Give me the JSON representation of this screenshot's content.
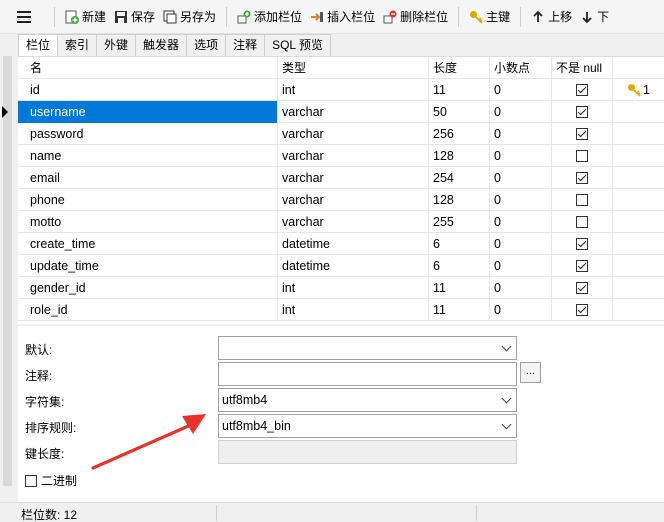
{
  "toolbar": {
    "new_label": "新建",
    "save_label": "保存",
    "save_as_label": "另存为",
    "add_field_label": "添加栏位",
    "insert_field_label": "插入栏位",
    "delete_field_label": "删除栏位",
    "primary_key_label": "主键",
    "move_up_label": "上移",
    "move_down_label": "下"
  },
  "tabs": [
    "栏位",
    "索引",
    "外键",
    "触发器",
    "选项",
    "注释",
    "SQL 预览"
  ],
  "grid": {
    "headers": {
      "name": "名",
      "type": "类型",
      "length": "长度",
      "decimals": "小数点",
      "not_null": "不是 null",
      "key": ""
    },
    "rows": [
      {
        "name": "id",
        "type": "int",
        "length": "11",
        "decimals": "0",
        "not_null": true,
        "key": "1"
      },
      {
        "name": "username",
        "type": "varchar",
        "length": "50",
        "decimals": "0",
        "not_null": true,
        "key": ""
      },
      {
        "name": "password",
        "type": "varchar",
        "length": "256",
        "decimals": "0",
        "not_null": true,
        "key": ""
      },
      {
        "name": "name",
        "type": "varchar",
        "length": "128",
        "decimals": "0",
        "not_null": false,
        "key": ""
      },
      {
        "name": "email",
        "type": "varchar",
        "length": "254",
        "decimals": "0",
        "not_null": true,
        "key": ""
      },
      {
        "name": "phone",
        "type": "varchar",
        "length": "128",
        "decimals": "0",
        "not_null": false,
        "key": ""
      },
      {
        "name": "motto",
        "type": "varchar",
        "length": "255",
        "decimals": "0",
        "not_null": false,
        "key": ""
      },
      {
        "name": "create_time",
        "type": "datetime",
        "length": "6",
        "decimals": "0",
        "not_null": true,
        "key": ""
      },
      {
        "name": "update_time",
        "type": "datetime",
        "length": "6",
        "decimals": "0",
        "not_null": true,
        "key": ""
      },
      {
        "name": "gender_id",
        "type": "int",
        "length": "11",
        "decimals": "0",
        "not_null": true,
        "key": ""
      },
      {
        "name": "role_id",
        "type": "int",
        "length": "11",
        "decimals": "0",
        "not_null": true,
        "key": ""
      }
    ]
  },
  "props": {
    "default_label": "默认:",
    "default_value": "",
    "comment_label": "注释:",
    "comment_value": "",
    "charset_label": "字符集:",
    "charset_value": "utf8mb4",
    "collation_label": "排序规则:",
    "collation_value": "utf8mb4_bin",
    "key_length_label": "键长度:",
    "key_length_value": "",
    "binary_label": "二进制",
    "ellipsis": "..."
  },
  "status": {
    "field_count": "栏位数: 12"
  },
  "colors": {
    "selection": "#0078d7",
    "arrow": "#e8332b",
    "key_icon": "#e0a800"
  }
}
